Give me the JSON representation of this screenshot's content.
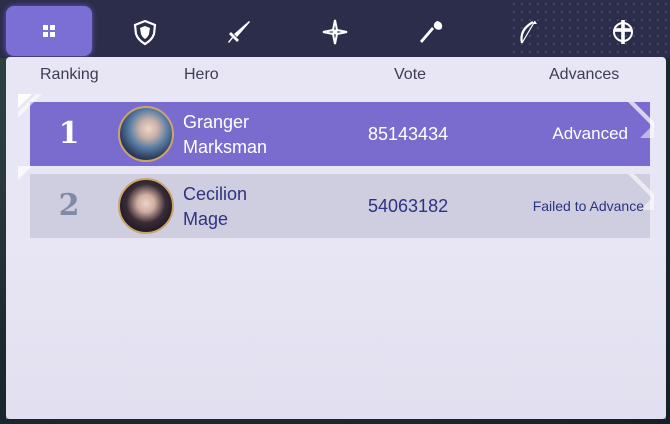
{
  "tabs": [
    {
      "name": "all",
      "icon": "grid-icon",
      "active": true
    },
    {
      "name": "tank",
      "icon": "shield-icon",
      "active": false
    },
    {
      "name": "fighter",
      "icon": "sword-icon",
      "active": false
    },
    {
      "name": "assassin",
      "icon": "shuriken-icon",
      "active": false
    },
    {
      "name": "mage",
      "icon": "staff-icon",
      "active": false
    },
    {
      "name": "marksman",
      "icon": "bow-icon",
      "active": false
    },
    {
      "name": "support",
      "icon": "cross-icon",
      "active": false
    }
  ],
  "table": {
    "columns": {
      "ranking": "Ranking",
      "hero": "Hero",
      "vote": "Vote",
      "advances": "Advances"
    },
    "rows": [
      {
        "rank": "1",
        "hero": "Granger",
        "role": "Marksman",
        "vote": "85143434",
        "advance": "Advanced"
      },
      {
        "rank": "2",
        "hero": "Cecilion",
        "role": "Mage",
        "vote": "54063182",
        "advance": "Failed to Advance"
      }
    ]
  },
  "colors": {
    "accent": "#7b6fd6",
    "tabbar": "#2b2d4a",
    "panel": "#e8e6f4",
    "row_advanced": "#7a6ccf",
    "row_failed": "#cfcde0",
    "text_dark": "#2c3380"
  }
}
